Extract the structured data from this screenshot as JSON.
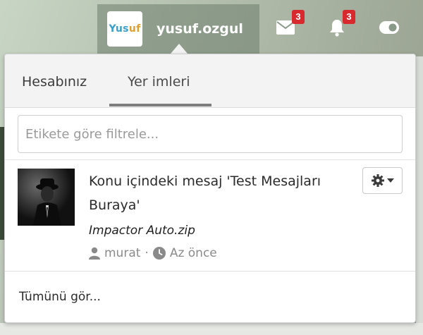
{
  "header": {
    "logo_text_part1": "Yus",
    "logo_text_part2": "uf",
    "username": "yusuf.ozgul",
    "messages_icon": "envelope-icon",
    "messages_count": "3",
    "alerts_icon": "bell-icon",
    "alerts_count": "3",
    "toggle_icon": "toggle-icon"
  },
  "popup": {
    "tabs": [
      {
        "label": "Hesabınız",
        "active": false
      },
      {
        "label": "Yer imleri",
        "active": true
      }
    ],
    "filter": {
      "placeholder": "Etikete göre filtrele...",
      "value": ""
    },
    "bookmarks": [
      {
        "title": "Konu içindeki mesaj 'Test Mesajları Buraya'",
        "attachment": "Impactor Auto.zip",
        "author": "murat",
        "time": "Az önce",
        "thumb_icon": "user-silhouette-image",
        "menu_icon": "gear-icon"
      }
    ],
    "footer_link": "Tümünü gör..."
  },
  "colors": {
    "badge": "#d8292f",
    "tab_underline": "#7d7d7d"
  }
}
